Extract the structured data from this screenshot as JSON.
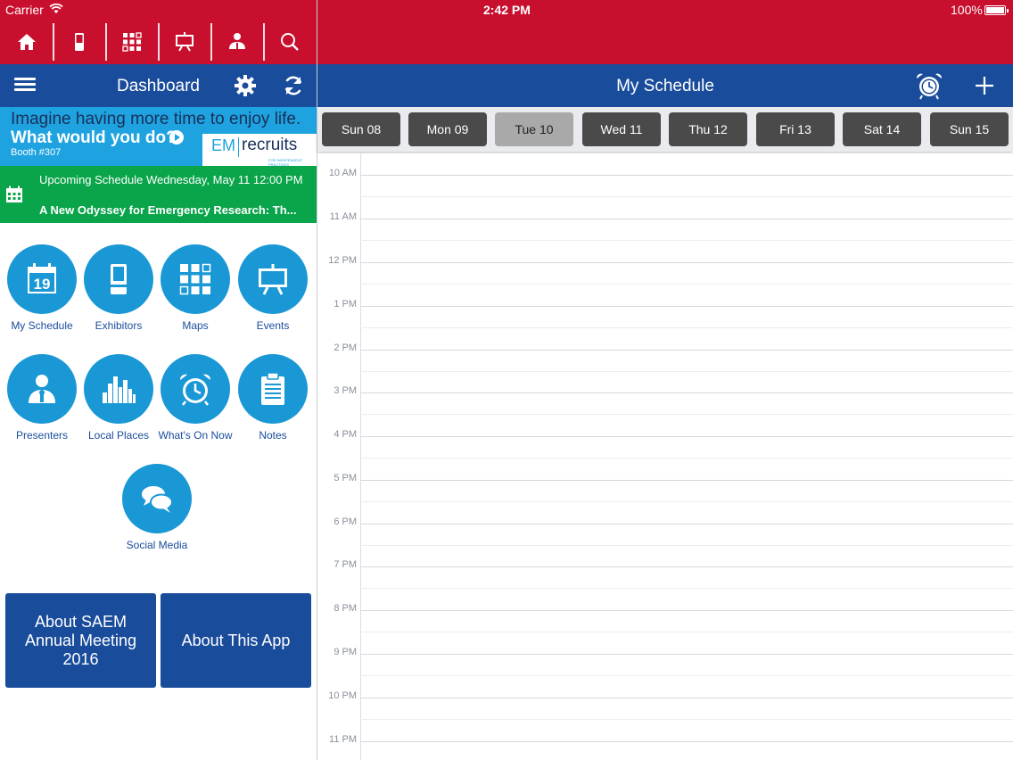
{
  "status": {
    "carrier": "Carrier",
    "time": "2:42 PM",
    "battery": "100%"
  },
  "toolbar": {
    "items": [
      {
        "icon": "home-icon"
      },
      {
        "icon": "exhibitor-booth-icon"
      },
      {
        "icon": "maps-grid-icon"
      },
      {
        "icon": "events-easel-icon"
      },
      {
        "icon": "presenter-icon"
      },
      {
        "icon": "search-icon"
      }
    ]
  },
  "dashboard": {
    "title": "Dashboard"
  },
  "banner": {
    "line1": "Imagine having more time to enjoy life.",
    "line2": "What would you do?",
    "line3": "Booth #307",
    "logo_em": "EM",
    "logo_recruits": "recruits",
    "logo_tag": "FOR INDEPENDENT PRACTICES"
  },
  "upcoming": {
    "line1": "Upcoming Schedule Wednesday, May 11 12:00 PM",
    "line2": "A New Odyssey for Emergency Research: Th..."
  },
  "tiles": [
    {
      "label": "My Schedule",
      "icon": "calendar-19-icon"
    },
    {
      "label": "Exhibitors",
      "icon": "exhibitor-booth-icon"
    },
    {
      "label": "Maps",
      "icon": "maps-grid-icon"
    },
    {
      "label": "Events",
      "icon": "events-easel-icon"
    },
    {
      "label": "Presenters",
      "icon": "presenter-icon"
    },
    {
      "label": "Local Places",
      "icon": "city-skyline-icon"
    },
    {
      "label": "What's On Now",
      "icon": "alarm-clock-icon"
    },
    {
      "label": "Notes",
      "icon": "notepad-icon"
    },
    {
      "label": "Social Media",
      "icon": "chat-bubbles-icon"
    }
  ],
  "about": {
    "saem": "About SAEM Annual Meeting 2016",
    "app": "About This App"
  },
  "schedule": {
    "title": "My Schedule",
    "days": [
      "Sun 08",
      "Mon 09",
      "Tue 10",
      "Wed 11",
      "Thu 12",
      "Fri 13",
      "Sat 14",
      "Sun 15"
    ],
    "selected_day": "Tue 10",
    "hours": [
      "10 AM",
      "11 AM",
      "12 PM",
      "1 PM",
      "2 PM",
      "3 PM",
      "4 PM",
      "5 PM",
      "6 PM",
      "7 PM",
      "8 PM",
      "9 PM",
      "10 PM",
      "11 PM"
    ]
  },
  "colors": {
    "red": "#c8102e",
    "blue": "#1a4c9c",
    "tile_blue": "#1a98d5",
    "green": "#0aa44a",
    "banner_blue": "#1ea3e0"
  }
}
